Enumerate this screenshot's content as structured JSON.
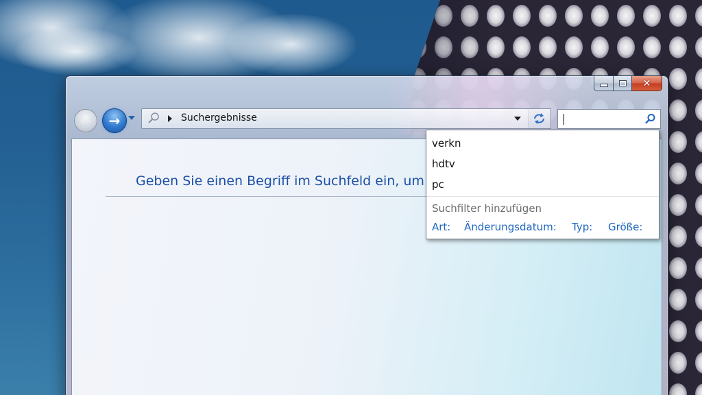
{
  "window": {
    "caption_buttons": {
      "minimize_icon": "minimize-icon",
      "maximize_icon": "maximize-icon",
      "close_glyph": "✕"
    }
  },
  "nav": {
    "back_glyph": "←",
    "forward_glyph": "→"
  },
  "address_bar": {
    "path_text": "Suchergebnisse"
  },
  "search": {
    "value": "",
    "placeholder": ""
  },
  "content": {
    "hint_text": "Geben Sie einen Begriff im Suchfeld ein, um"
  },
  "suggestions": {
    "history": [
      "verkn",
      "hdtv",
      "pc"
    ],
    "filter_heading": "Suchfilter hinzufügen",
    "filters": [
      "Art:",
      "Änderungsdatum:",
      "Typ:",
      "Größe:"
    ]
  },
  "colors": {
    "link_blue": "#1f67c0",
    "hint_blue": "#1c4fa4",
    "close_red": "#c23e22"
  }
}
